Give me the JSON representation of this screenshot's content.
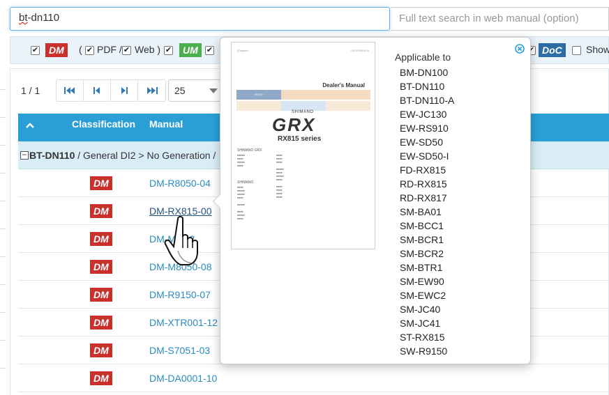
{
  "search": {
    "value_prefix": "bt",
    "value_rest": "-dn110",
    "fulltext_placeholder": "Full text search in web manual (option)"
  },
  "filters": {
    "dm_badge": "DM",
    "open_paren": "(",
    "pdf_label": "PDF /",
    "web_label": "Web )",
    "um_badge": "UM",
    "doc_badge": "DoC",
    "show_label": "Show"
  },
  "pager": {
    "count": "1 / 1",
    "page_size": "25"
  },
  "table": {
    "col_classification": "Classification",
    "col_manual": "Manual",
    "group": {
      "name": "BT-DN110",
      "path": " / General DI2 > No Generation /"
    },
    "rows": [
      {
        "badge": "DM",
        "manual": "DM-R8050-04"
      },
      {
        "badge": "DM",
        "manual": "DM-RX815-00"
      },
      {
        "badge": "DM",
        "manual": "DM-M...12"
      },
      {
        "badge": "DM",
        "manual": "DM-M8050-08"
      },
      {
        "badge": "DM",
        "manual": "DM-R9150-07"
      },
      {
        "badge": "DM",
        "manual": "DM-XTR001-12"
      },
      {
        "badge": "DM",
        "manual": "DM-S7051-03"
      },
      {
        "badge": "DM",
        "manual": "DM-DA0001-10"
      }
    ]
  },
  "popup": {
    "applicable_title": "Applicable to",
    "models": [
      "BM-DN100",
      "BT-DN110",
      "BT-DN110-A",
      "EW-JC130",
      "EW-RS910",
      "EW-SD50",
      "EW-SD50-I",
      "FD-RX815",
      "RD-RX815",
      "RD-RX817",
      "SM-BA01",
      "SM-BCC1",
      "SM-BCR1",
      "SM-BCR2",
      "SM-BTR1",
      "SM-EW90",
      "SM-EWC2",
      "SM-JC40",
      "SM-JC41",
      "ST-RX815",
      "SW-R9150"
    ],
    "thumbnail": {
      "top_left": "(English)",
      "top_right": "DM-RX815-00",
      "doc_title": "Dealer's Manual",
      "brand": "SHIMANO",
      "logo": "GRX",
      "series": "RX815 series",
      "cat_road": "ROAD",
      "col_header": "SHIMANO GRX",
      "col_header2": "SHIMANO"
    }
  },
  "colors": {
    "accent": "#2a9fd6",
    "dm": "#c9302c",
    "um": "#4cae4c",
    "doc": "#2e6da4",
    "link": "#2a8abf"
  }
}
